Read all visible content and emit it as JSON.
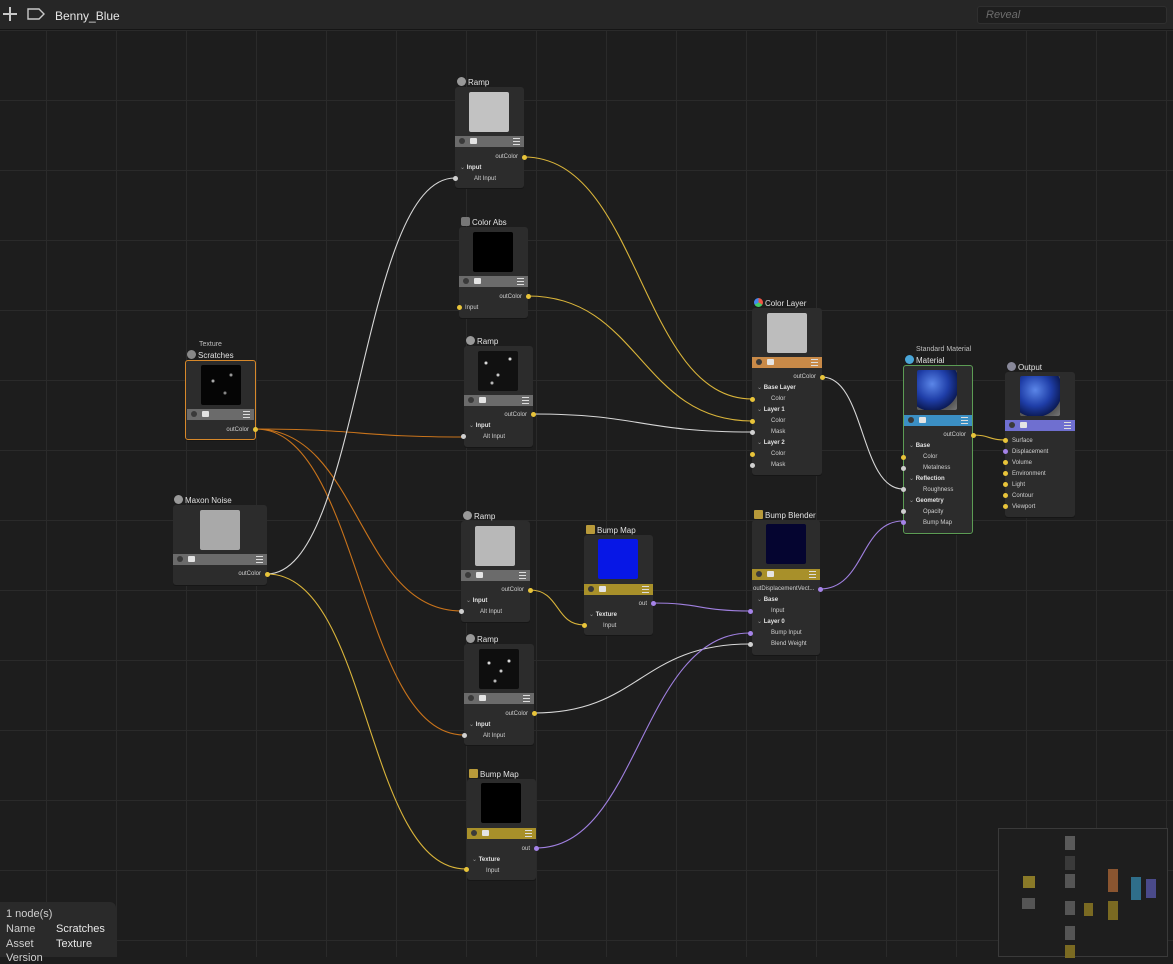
{
  "topbar": {
    "breadcrumb": "Benny_Blue",
    "search_placeholder": "Reveal"
  },
  "colors": {
    "canvas": "#1d1d1d",
    "wire_color": "#d9b43a",
    "wire_float": "#d9d9d9",
    "wire_vector": "#a080e0",
    "wire_selected": "#d27f1e",
    "port_color": "#e8c43a",
    "port_vector": "#a583e8",
    "port_float": "#d0d0d0",
    "selected_border": "#d7882a",
    "material_border": "#5c9c54"
  },
  "nodes": {
    "scratches": {
      "category": "Texture",
      "title": "Scratches",
      "out": "outColor",
      "icon": "texture-icon"
    },
    "maxon_noise": {
      "title": "Maxon Noise",
      "out": "outColor",
      "icon": "noise-icon"
    },
    "ramp1": {
      "title": "Ramp",
      "out": "outColor",
      "section": "Input",
      "input": "Alt Input",
      "icon": "ramp-icon"
    },
    "color_abs": {
      "title": "Color Abs",
      "out": "outColor",
      "input": "Input",
      "icon": "color-abs-icon"
    },
    "ramp2": {
      "title": "Ramp",
      "out": "outColor",
      "section": "Input",
      "input": "Alt Input",
      "icon": "ramp-icon"
    },
    "ramp3": {
      "title": "Ramp",
      "out": "outColor",
      "section": "Input",
      "input": "Alt Input",
      "icon": "ramp-icon"
    },
    "ramp4": {
      "title": "Ramp",
      "out": "outColor",
      "section": "Input",
      "input": "Alt Input",
      "icon": "ramp-icon"
    },
    "bump_map1": {
      "title": "Bump Map",
      "out": "out",
      "section": "Texture",
      "input": "Input",
      "icon": "bump-map-icon"
    },
    "bump_map2": {
      "title": "Bump Map",
      "out": "out",
      "section": "Texture",
      "input": "Input",
      "icon": "bump-map-icon"
    },
    "color_layer": {
      "title": "Color Layer",
      "out": "outColor",
      "icon": "color-layer-icon",
      "base_layer": "Base Layer",
      "color": "Color",
      "layer1": "Layer 1",
      "layer1_color": "Color",
      "layer1_mask": "Mask",
      "layer2": "Layer 2",
      "layer2_color": "Color",
      "layer2_mask": "Mask"
    },
    "bump_blender": {
      "title": "Bump Blender",
      "out": "outDisplacementVect...",
      "icon": "bump-blender-icon",
      "base": "Base",
      "base_input": "Input",
      "layer0": "Layer 0",
      "bump_input": "Bump Input",
      "blend_weight": "Blend Weight"
    },
    "material": {
      "category": "Standard Material",
      "title": "Material",
      "out": "outColor",
      "icon": "material-icon",
      "base": "Base",
      "color": "Color",
      "metalness": "Metalness",
      "reflection": "Reflection",
      "roughness": "Roughness",
      "geometry": "Geometry",
      "opacity": "Opacity",
      "bump_map": "Bump Map"
    },
    "output": {
      "title": "Output",
      "icon": "output-icon",
      "ports": [
        "Surface",
        "Displacement",
        "Volume",
        "Environment",
        "Light",
        "Contour",
        "Viewport"
      ]
    }
  },
  "info_panel": {
    "count": "1 node(s)",
    "name_label": "Name",
    "name_value": "Scratches",
    "asset_label": "Asset",
    "asset_value": "Texture",
    "version_label": "Version"
  }
}
